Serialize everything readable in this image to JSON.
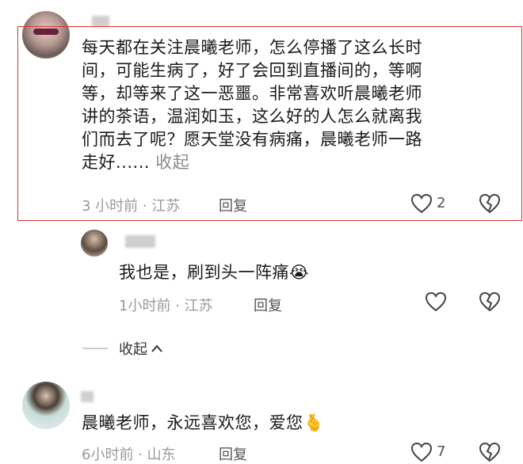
{
  "comments": [
    {
      "text_lines": [
        "每天都在关注晨曦老师，怎么停播了这么长时",
        "间，可能生病了，好了会回到直播间的，等啊",
        "等，却等来了这一恶噩。非常喜欢听晨曦老师",
        "讲的茶语，温润如玉，这么好的人怎么就离我",
        "们而去了呢？愿天堂没有病痛，晨曦老师一路"
      ],
      "last_line": "走好......",
      "collapse_inline": "收起",
      "meta": "3 小时前 · 江苏",
      "reply_label": "回复",
      "like_count": "2"
    },
    {
      "text": "我也是，刷到头一阵痛",
      "emoji": "😭",
      "meta": "1小时前 · 江苏",
      "reply_label": "回复"
    },
    {
      "text": "晨曦老师，永远喜欢您，爱您",
      "emoji": "🫰",
      "meta": "6小时前 · 山东",
      "reply_label": "回复",
      "like_count": "7"
    }
  ],
  "collapse_replies": "收起",
  "icons": {
    "like": "heart-outline-icon",
    "dislike": "broken-heart-icon",
    "collapse": "chevron-up-icon"
  },
  "colors": {
    "highlight_border": "#d33333",
    "meta": "#9a9a9a"
  }
}
